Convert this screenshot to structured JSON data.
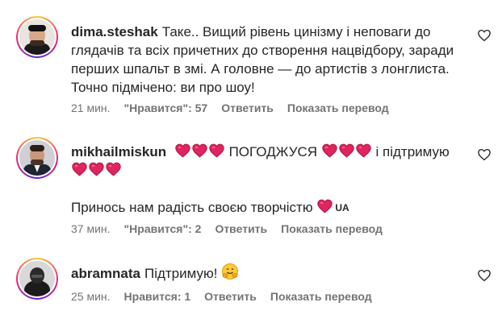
{
  "comments": [
    {
      "username": "dima.steshak",
      "text": "Таке.. Вищий рівень цинізму і неповаги до глядачів та всіх причетних до створення нацвідбору, заради перших шпальт в змі. А головне — до артистів з лонглиста. Точно підмічено: ви про шоу!",
      "time": "21 мин.",
      "likes": "\"Нравится\": 57",
      "reply": "Ответить",
      "translate": "Показать перевод"
    },
    {
      "username": "mikhailmiskun",
      "text_1": "ПОГОДЖУСЯ",
      "text_2": "і підтримую",
      "text_3": "Принось нам радість своєю творчістю",
      "flag": "UA",
      "time": "37 мин.",
      "likes": "\"Нравится\": 2",
      "reply": "Ответить",
      "translate": "Показать перевод"
    },
    {
      "username": "abramnata",
      "text": "Підтримую!",
      "time": "25 мин.",
      "likes": "Нравится: 1",
      "reply": "Ответить",
      "translate": "Показать перевод"
    }
  ],
  "icons": {
    "like": "heart-outline-icon",
    "emoji_heart": "red-heart-emoji",
    "emoji_hug": "hugging-face-emoji"
  },
  "colors": {
    "text": "#262626",
    "meta": "#737373",
    "heart": "#e0245e"
  }
}
